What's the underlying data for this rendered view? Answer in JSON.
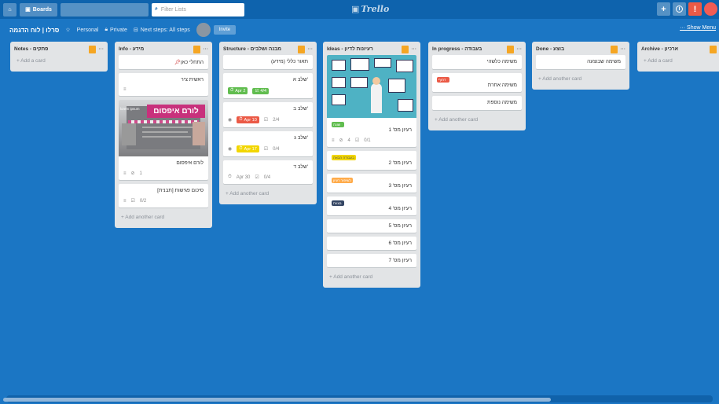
{
  "topbar": {
    "boards_label": "Boards",
    "filter_placeholder": "Filter Lists",
    "logo": "Trello",
    "plus": "+",
    "info": "i",
    "bell": "!"
  },
  "board": {
    "title": "סרלו | לוח הדגמה",
    "visibility_team": "Personal",
    "visibility": "Private",
    "powerup": "Next steps: All steps",
    "invite": "Invite",
    "show_menu": "Show Menu"
  },
  "lists": [
    {
      "title": "Notes - פתקים",
      "add": "+ Add a card"
    },
    {
      "title": "Info - מידע",
      "cards": [
        "התחלי כאן",
        "ראשית ציר",
        "לורם איפסום",
        "סיכום פגישות [תבנית]"
      ],
      "card_meta": {
        "c3_attach": "1",
        "c4_check": "0/2"
      },
      "cover_text": "לורם איפסום",
      "cover_sub": "lorem ipsum",
      "add": "+ Add another card"
    },
    {
      "title": "Structure - מבנה ושלבים",
      "cards": [
        "תאור כללי (מידע)",
        "שלב א'",
        "שלב ב'",
        "שלב ג'",
        "שלב ד'"
      ],
      "meta": {
        "a_due": "Apr 2",
        "a_check": "4/4",
        "b_due": "Apr 10",
        "b_check": "2/4",
        "c_due": "Apr 17",
        "c_check": "0/4",
        "d_due": "Apr 30",
        "d_check": "0/4"
      },
      "add": "+ Add another card"
    },
    {
      "title": "Ideas - רעיונות לדיון",
      "cards": [
        "רעיון מס' 1",
        "רעיון מס' 2",
        "רעיון מס' 3",
        "רעיון מס' 4",
        "רעיון מס' 5",
        "רעיון מס' 6",
        "רעיון מס' 7"
      ],
      "meta": {
        "i1_attach": "4",
        "i1_check": "0/1"
      },
      "labels": {
        "l1": "שונה",
        "l2": "בעבודה הבאה",
        "l3": "לשיפור רעיון",
        "l4": "בצוות"
      },
      "add": "+ Add another card"
    },
    {
      "title": "In progress - בעבודה",
      "cards": [
        "משימה כלשהי",
        "משימה אחרת",
        "משימה נוספת"
      ],
      "label": "דחוף",
      "add": "+ Add another card"
    },
    {
      "title": "Done - בוצע",
      "cards": [
        "משימה שבוצעה"
      ],
      "add": "+ Add another card"
    },
    {
      "title": "Archive - ארכיון",
      "add": "+ Add a card"
    }
  ],
  "colors": {
    "board_bg": "#1b76c4",
    "green": "#61bd4f",
    "yellow": "#f2d600",
    "orange": "#ffab4a",
    "red": "#eb5a46",
    "navy": "#344563"
  }
}
